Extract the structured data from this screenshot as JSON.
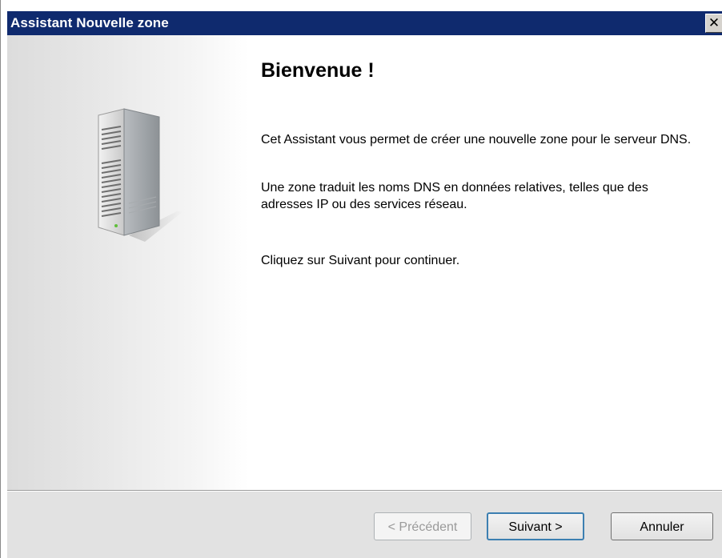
{
  "window": {
    "title": "Assistant Nouvelle zone",
    "close_label": "✕"
  },
  "sidebar": {
    "illustration": "server-icon"
  },
  "content": {
    "heading": "Bienvenue !",
    "paragraph1": "Cet Assistant vous permet de créer une nouvelle zone pour le serveur DNS.",
    "paragraph2": "Une zone traduit les noms DNS en données relatives, telles que des adresses IP ou des services réseau.",
    "paragraph3": "Cliquez sur Suivant pour continuer."
  },
  "buttons": {
    "previous": "< Précédent",
    "next": "Suivant >",
    "cancel": "Annuler"
  },
  "colors": {
    "titlebar": "#0f2a6e",
    "footer": "#e2e2e2"
  }
}
